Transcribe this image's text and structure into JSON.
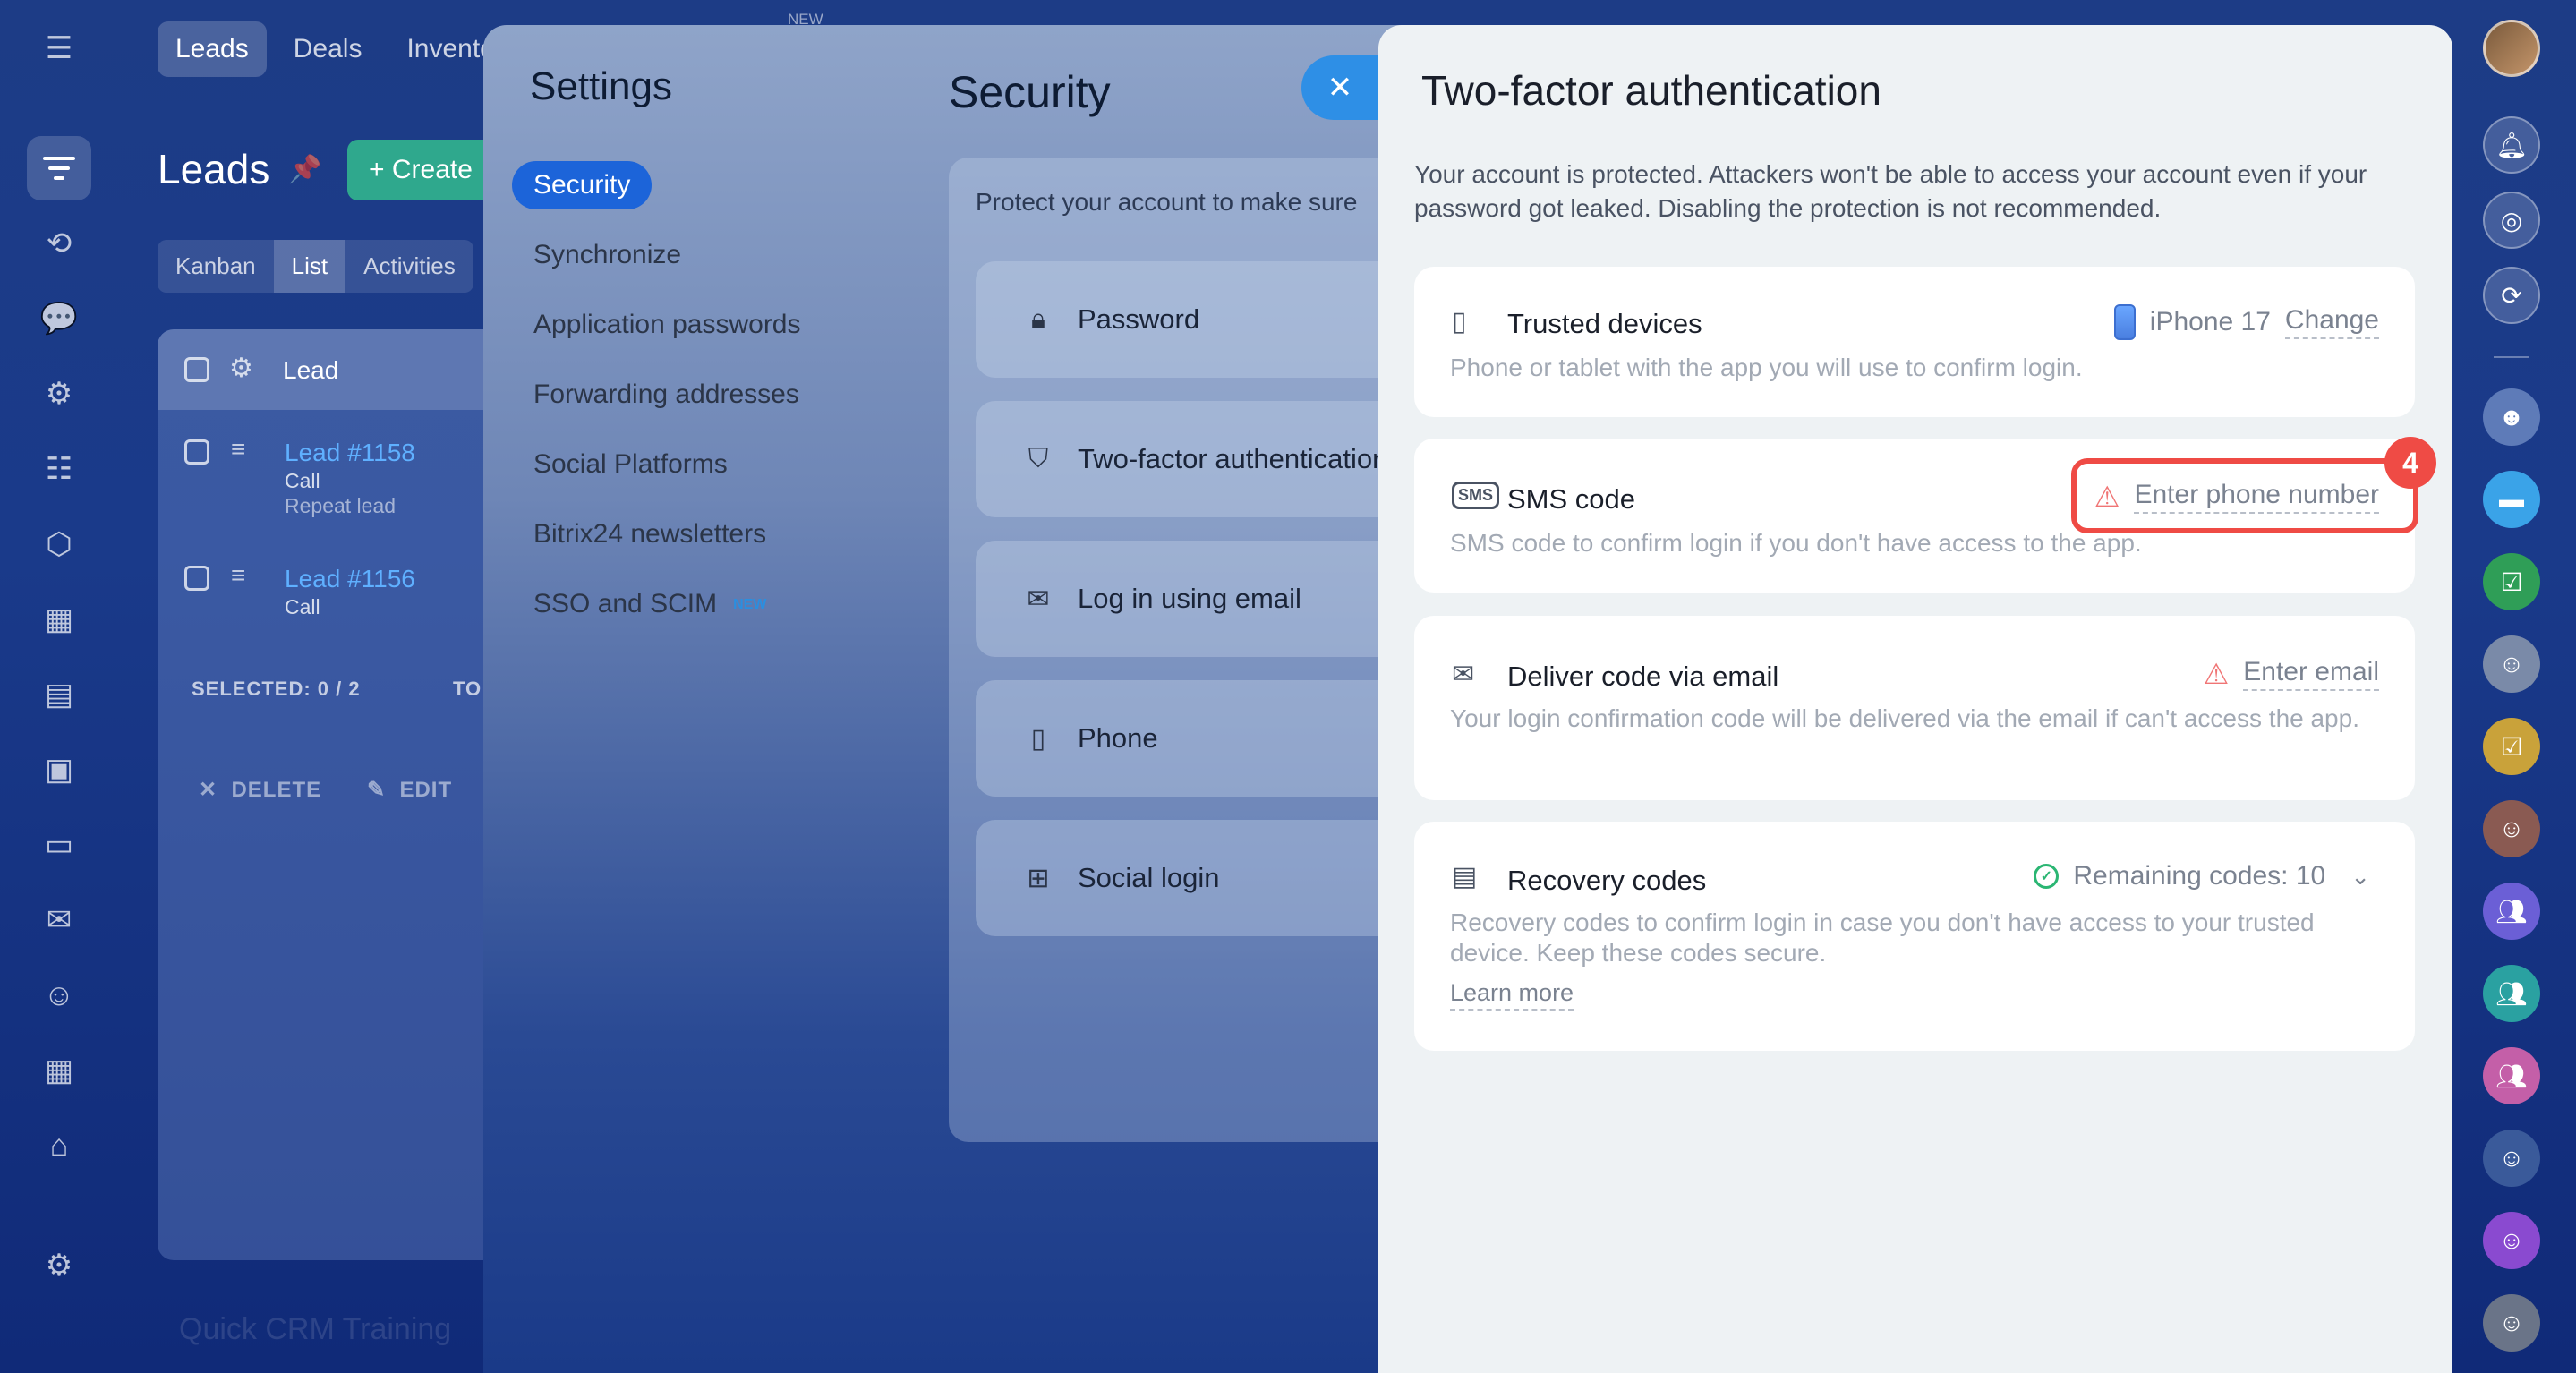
{
  "top_tabs": [
    "Leads",
    "Deals",
    "Invento"
  ],
  "new_label": "NEW",
  "crm": {
    "title": "Leads",
    "create_label": "+ Create",
    "view_tabs": [
      "Kanban",
      "List",
      "Activities"
    ],
    "grid_header": "Lead",
    "rows": [
      {
        "title": "Lead #1158",
        "sub": "Call",
        "note": "Repeat lead"
      },
      {
        "title": "Lead #1156",
        "sub": "Call",
        "note": ""
      }
    ],
    "selected_label": "SELECTED: 0 / 2",
    "total_label": "TO",
    "delete_label": "DELETE",
    "edit_label": "EDIT",
    "bottom_ghost": "Quick CRM Training"
  },
  "settings": {
    "title": "Settings",
    "nav": [
      {
        "label": "Security",
        "active": true,
        "badge": ""
      },
      {
        "label": "Synchronize",
        "active": false,
        "badge": ""
      },
      {
        "label": "Application passwords",
        "active": false,
        "badge": ""
      },
      {
        "label": "Forwarding addresses",
        "active": false,
        "badge": ""
      },
      {
        "label": "Social Platforms",
        "active": false,
        "badge": ""
      },
      {
        "label": "Bitrix24 newsletters",
        "active": false,
        "badge": ""
      },
      {
        "label": "SSO and SCIM",
        "active": false,
        "badge": "NEW"
      }
    ]
  },
  "security": {
    "title": "Security",
    "intro": "Protect your account to make sure",
    "items": [
      {
        "icon": "lock-icon",
        "label": "Password"
      },
      {
        "icon": "shield-icon",
        "label": "Two-factor authentication"
      },
      {
        "icon": "envelope-icon",
        "label": "Log in using email"
      },
      {
        "icon": "phone-icon",
        "label": "Phone"
      },
      {
        "icon": "grid-icon",
        "label": "Social login"
      }
    ]
  },
  "tfa": {
    "title": "Two-factor authentication",
    "description": "Your account is protected. Attackers won't be able to access your account even if your password got leaked. Disabling the protection is not recommended.",
    "trusted": {
      "title": "Trusted devices",
      "desc": "Phone or tablet with the app you will use to confirm login.",
      "device": "iPhone 17",
      "action": "Change"
    },
    "sms": {
      "title": "SMS code",
      "desc": "SMS code to confirm login if you don't have access to the app.",
      "action": "Enter phone number",
      "icon_text": "SMS"
    },
    "email": {
      "title": "Deliver code via email",
      "desc": "Your login confirmation code will be delivered via the email if can't access the app.",
      "action": "Enter email"
    },
    "recovery": {
      "title": "Recovery codes",
      "desc": "Recovery codes to confirm login in case you don't have access to your trusted device. Keep these codes secure.",
      "status": "Remaining codes: 10",
      "learn_more": "Learn more"
    }
  },
  "step_number": "4",
  "colors": {
    "accent_blue": "#1c64d9",
    "highlight_red": "#ef4b45",
    "success_green": "#2bb673",
    "warning_red": "#f07575"
  }
}
